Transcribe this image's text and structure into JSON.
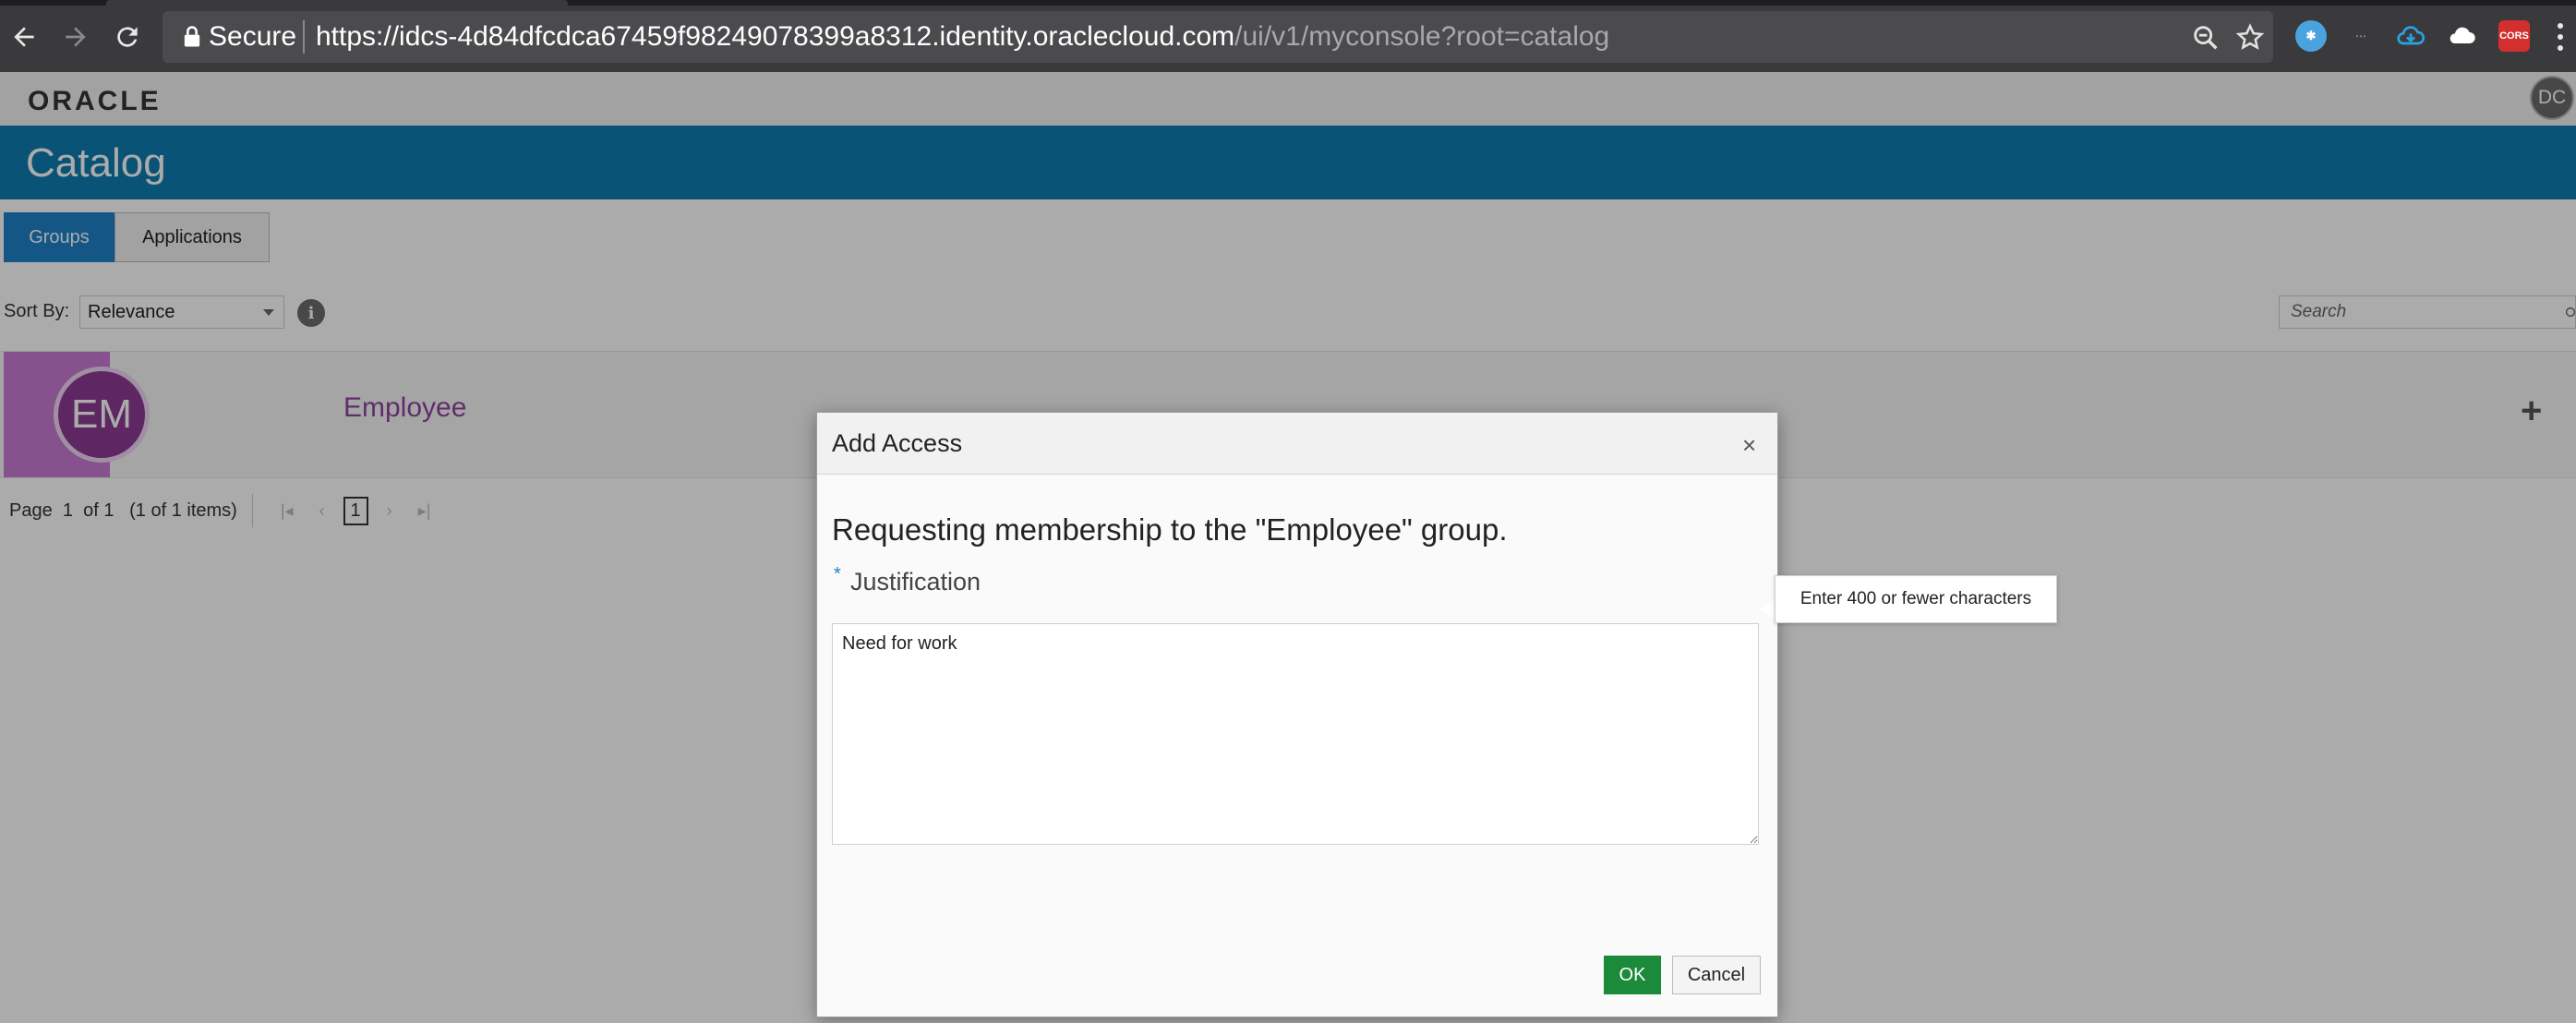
{
  "browser": {
    "secure_label": "Secure",
    "url_host": "https://idcs-4d84dfcdca67459f98249078399a8312.identity.oraclecloud.com",
    "url_path": "/ui/v1/myconsole?root=catalog",
    "icons": [
      "back-icon",
      "forward-icon",
      "reload-icon",
      "lock-icon",
      "zoom-icon",
      "bookmark-star-icon",
      "menu-icon"
    ],
    "extensions": [
      {
        "name": "extension-snowflake-icon",
        "color": "#4aa3df"
      },
      {
        "name": "extension-text-icon",
        "color": "#777777"
      },
      {
        "name": "extension-cloud-download-icon",
        "color": "#29a3e0"
      },
      {
        "name": "extension-cloud-icon",
        "color": "#ffffff"
      },
      {
        "name": "extension-cors-icon",
        "color": "#d32f2f",
        "label": "CORS"
      }
    ]
  },
  "header": {
    "logo": "ORACLE",
    "user_initials": "DC"
  },
  "banner": {
    "title": "Catalog",
    "color": "#0c7cb0"
  },
  "tabs": [
    {
      "label": "Groups",
      "active": true
    },
    {
      "label": "Applications",
      "active": false
    }
  ],
  "toolbar": {
    "sort_label": "Sort By:",
    "sort_value": "Relevance",
    "search_placeholder": "Search"
  },
  "results": [
    {
      "initials": "EM",
      "name": "Employee"
    }
  ],
  "pager": {
    "page_label": "Page",
    "page_num": "1",
    "of_label": "of 1",
    "items_label": "(1 of 1 items)",
    "current_page": "1"
  },
  "modal": {
    "title": "Add Access",
    "close_glyph": "×",
    "message": "Requesting membership to the \"Employee\" group.",
    "required_marker": "*",
    "justification_label": "Justification",
    "justification_value": "Need for work",
    "tooltip": "Enter 400 or fewer characters",
    "ok_label": "OK",
    "cancel_label": "Cancel",
    "ok_color": "#1b8a3a"
  }
}
